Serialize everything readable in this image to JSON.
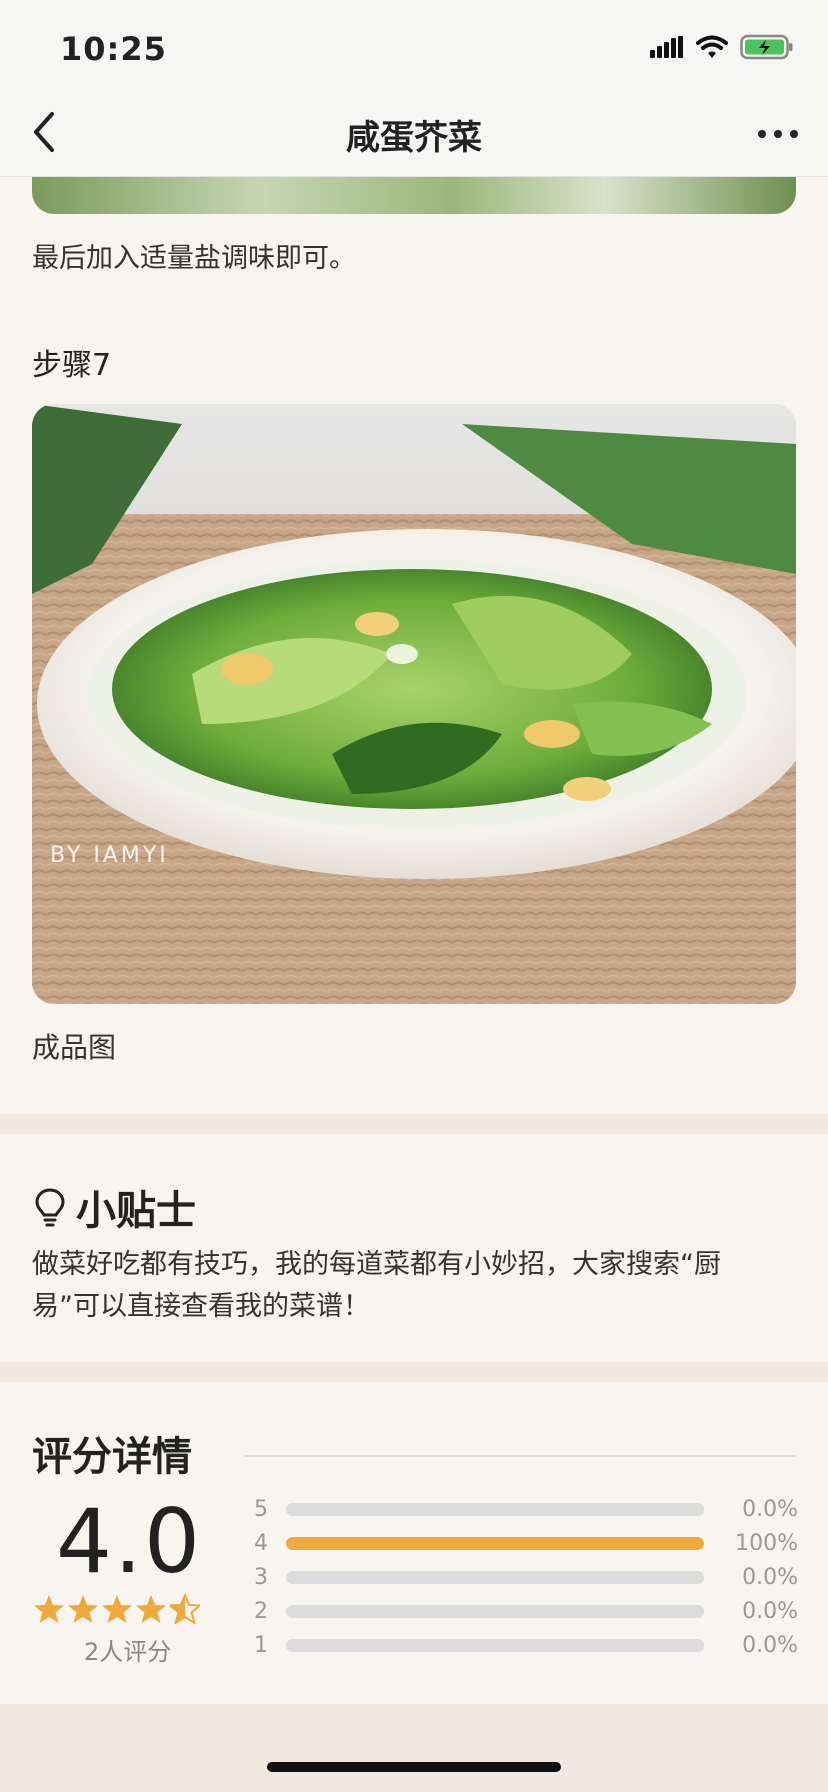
{
  "status_bar": {
    "time": "10:25"
  },
  "nav": {
    "title": "咸蛋芥菜"
  },
  "steps": {
    "prev_text": "最后加入适量盐调味即可。",
    "step7_title": "步骤7",
    "step7_watermark": "BY IAMYI",
    "step7_caption": "成品图"
  },
  "tips": {
    "title": "小贴士",
    "body": "做菜好吃都有技巧，我的每道菜都有小妙招，大家搜索“厨易”可以直接查看我的菜谱！"
  },
  "rating": {
    "title": "评分详情",
    "average": "4.0",
    "average_value": 4.0,
    "count_label": "2人评分",
    "star_color": "#f0a93c",
    "rows": [
      {
        "label": "5",
        "percent": "0.0%",
        "fraction": 0.0
      },
      {
        "label": "4",
        "percent": "100%",
        "fraction": 1.0
      },
      {
        "label": "3",
        "percent": "0.0%",
        "fraction": 0.0
      },
      {
        "label": "2",
        "percent": "0.0%",
        "fraction": 0.0
      },
      {
        "label": "1",
        "percent": "0.0%",
        "fraction": 0.0
      }
    ]
  },
  "icons": [
    "back-chevron-icon",
    "more-dots-icon",
    "signal-icon",
    "wifi-icon",
    "battery-charging-icon",
    "lightbulb-icon",
    "star-icon"
  ]
}
